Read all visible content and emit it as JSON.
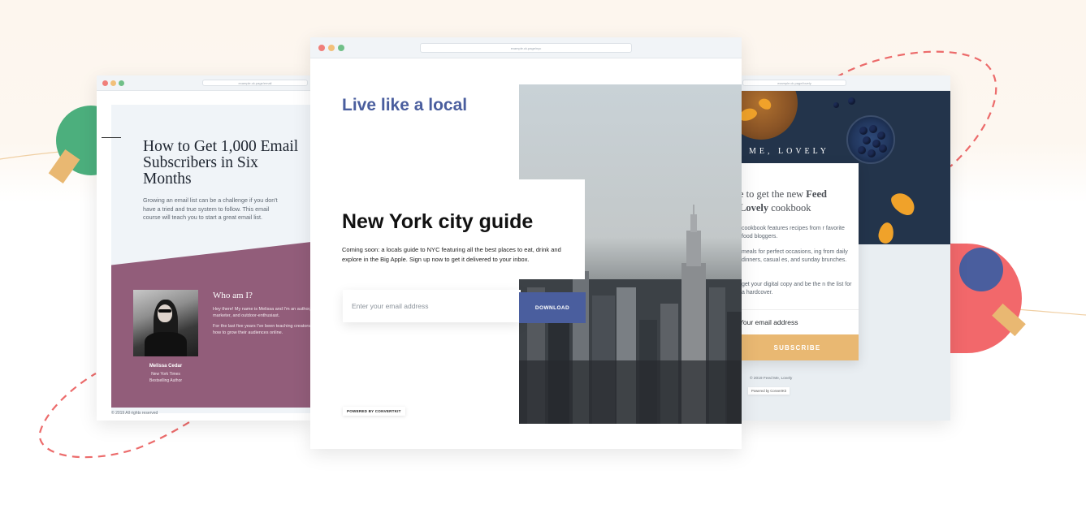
{
  "colors": {
    "accent_blue": "#4a5e9e",
    "accent_orange": "#e9b872",
    "accent_red": "#f2686b",
    "accent_green": "#4caf7d",
    "purple": "#925d7a"
  },
  "left_window": {
    "url": "example.ck.page/email",
    "title": "How to Get 1,000 Email Subscribers in Six Months",
    "description": "Growing an email list can be a challenge if you don't have a tried and true system to follow. This email course will teach you to start a great email list.",
    "who_heading": "Who am I?",
    "bio_1": "Hey there! My name is Melissa and I'm an author, marketer, and outdoor-enthusiast.",
    "bio_2": "For the last five years I've been teaching creators how to grow their audiences online.",
    "author_name": "Melissa Cedar",
    "author_role_1": "New York Times",
    "author_role_2": "Bestselling Author",
    "footer": "© 2019 All rights reserved"
  },
  "center_window": {
    "url": "example.ck.page/nyc",
    "tagline": "Live like a local",
    "title": "New York city guide",
    "description": "Coming soon: a locals guide to NYC featuring all the best places to eat, drink and explore in the Big Apple. Sign up now to get it delivered to your inbox.",
    "email_placeholder": "Enter your email address",
    "button_label": "DOWNLOAD",
    "powered_by": "POWERED BY CONVERTKIT"
  },
  "right_window": {
    "url": "example.ck.page/lovely",
    "logo_text": "ME, LOVELY",
    "heading_pre": "e to get the new ",
    "heading_bold_1": "Feed",
    "heading_bold_2": "Lovely",
    "heading_post": " cookbook",
    "paragraph_1": "cookbook features recipes from r favorite food bloggers.",
    "paragraph_2": "meals for perfect occasions, ing from daily dinners, casual es, and sunday brunches.",
    "paragraph_3": "get your digital copy and be the n the list for a hardcover.",
    "email_placeholder": "Your email address",
    "button_label": "SUBSCRIBE",
    "copyright": "© 2019 Feed Me, Lovely",
    "powered_by": "Powered by ConvertKit"
  }
}
